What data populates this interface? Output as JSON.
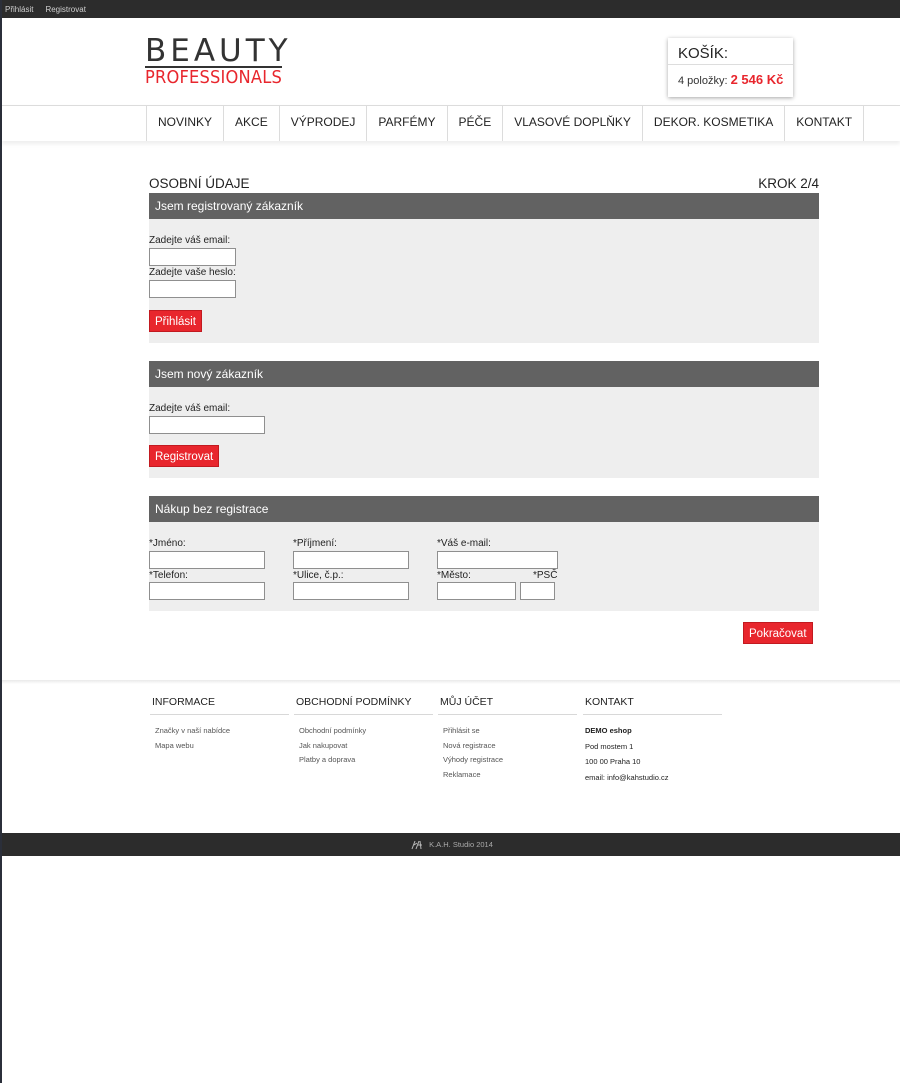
{
  "topbar": {
    "login": "Přihlásit",
    "register": "Registrovat"
  },
  "logo": {
    "line1": "BEAUTY",
    "line2": "PROFESSIONALS"
  },
  "cart": {
    "title": "KOŠÍK:",
    "items": "4 položky:",
    "price": "2 546 Kč"
  },
  "nav": [
    "NOVINKY",
    "AKCE",
    "VÝPRODEJ",
    "PARFÉMY",
    "PÉČE",
    "VLASOVÉ DOPLŇKY",
    "DEKOR. KOSMETIKA",
    "KONTAKT"
  ],
  "page": {
    "title": "OSOBNÍ ÚDAJE",
    "step": "KROK 2/4"
  },
  "registered": {
    "heading": "Jsem registrovaný zákazník",
    "email_label": "Zadejte váš email:",
    "password_label": "Zadejte vaše heslo:",
    "button": "Přihlásit"
  },
  "newcustomer": {
    "heading": "Jsem nový zákazník",
    "email_label": "Zadejte váš email:",
    "button": "Registrovat"
  },
  "guest": {
    "heading": "Nákup bez registrace",
    "first_name": "*Jméno:",
    "last_name": "*Příjmení:",
    "email": "*Váš e-mail:",
    "phone": "*Telefon:",
    "street": "*Ulice, č.p.:",
    "city": "*Město:",
    "zip": "*PSČ"
  },
  "continue_button": "Pokračovat",
  "footer": {
    "info": {
      "heading": "INFORMACE",
      "links": [
        "Značky v naší nabídce",
        "Mapa webu"
      ]
    },
    "terms": {
      "heading": "OBCHODNÍ PODMÍNKY",
      "links": [
        "Obchodní podmínky",
        "Jak nakupovat",
        "Platby a doprava"
      ]
    },
    "account": {
      "heading": "MŮJ ÚČET",
      "links": [
        "Přihlásit se",
        "Nová registrace",
        "Výhody registrace",
        "Reklamace"
      ]
    },
    "contact": {
      "heading": "KONTAKT",
      "name": "DEMO eshop",
      "street": "Pod mostem 1",
      "city": "100 00 Praha 10",
      "email": "email: info@kahstudio.cz"
    }
  },
  "copyright": "K.A.H. Studio 2014",
  "colors": {
    "accent": "#e8262d",
    "panel_head": "#626262",
    "panel_body": "#eeeeee",
    "dark_bar": "#2c2c2c"
  }
}
